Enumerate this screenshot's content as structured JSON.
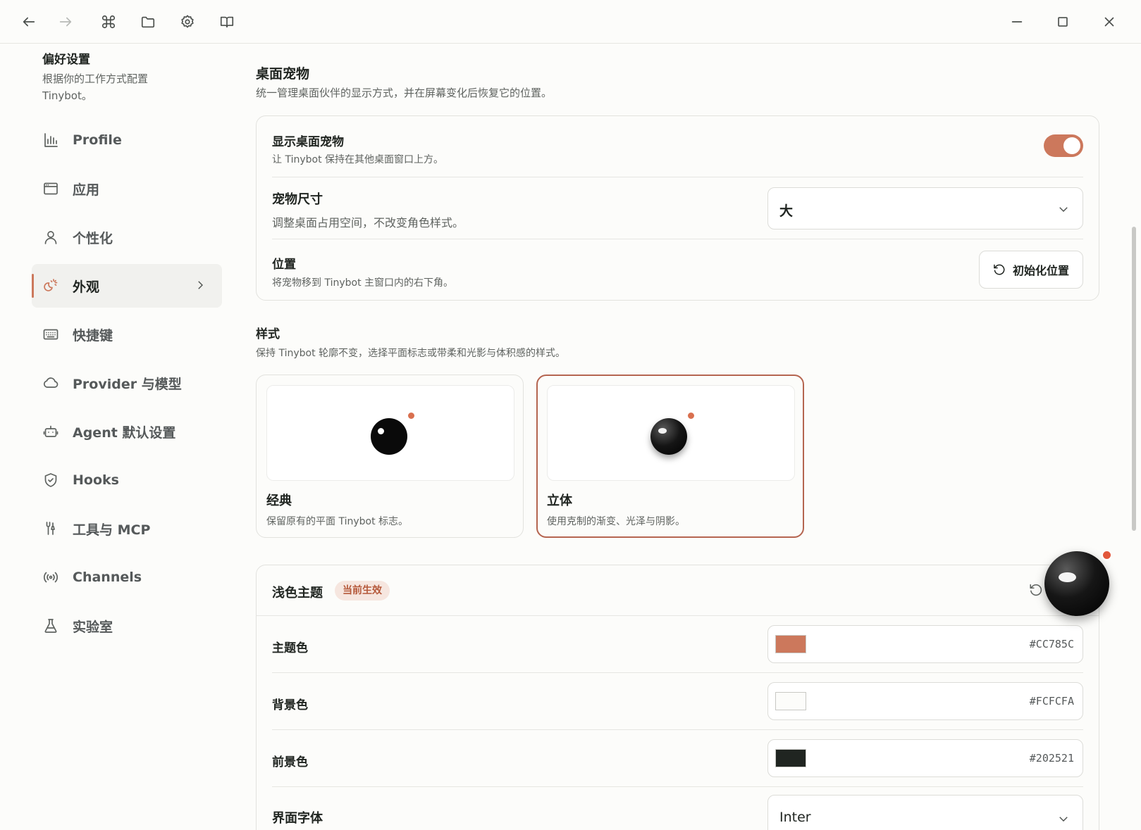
{
  "sidebar": {
    "title": "偏好设置",
    "subtitle": "根据你的工作方式配置 Tinybot。",
    "items": [
      {
        "label": "Profile"
      },
      {
        "label": "应用"
      },
      {
        "label": "个性化"
      },
      {
        "label": "外观"
      },
      {
        "label": "快捷键"
      },
      {
        "label": "Provider 与模型"
      },
      {
        "label": "Agent 默认设置"
      },
      {
        "label": "Hooks"
      },
      {
        "label": "工具与 MCP"
      },
      {
        "label": "Channels"
      },
      {
        "label": "实验室"
      }
    ],
    "active_index": 3
  },
  "pet_section": {
    "title": "桌面宠物",
    "subtitle": "统一管理桌面伙伴的显示方式，并在屏幕变化后恢复它的位置。",
    "show": {
      "title": "显示桌面宠物",
      "subtitle": "让 Tinybot 保持在其他桌面窗口上方。",
      "enabled": true
    },
    "size": {
      "title": "宠物尺寸",
      "subtitle": "调整桌面占用空间，不改变角色样式。",
      "value": "大"
    },
    "position": {
      "title": "位置",
      "subtitle": "将宠物移到 Tinybot 主窗口内的右下角。",
      "button_label": "初始化位置"
    }
  },
  "style_section": {
    "title": "样式",
    "subtitle": "保持 Tinybot 轮廓不变，选择平面标志或带柔和光影与体积感的样式。",
    "options": [
      {
        "name": "经典",
        "desc": "保留原有的平面 Tinybot 标志。",
        "selected": false
      },
      {
        "name": "立体",
        "desc": "使用克制的渐变、光泽与阴影。",
        "selected": true
      }
    ]
  },
  "theme": {
    "title": "浅色主题",
    "badge": "当前生效",
    "rows": [
      {
        "label": "主题色",
        "hex": "#CC785C"
      },
      {
        "label": "背景色",
        "hex": "#FCFCFA"
      },
      {
        "label": "前景色",
        "hex": "#202521"
      }
    ],
    "font": {
      "label": "界面字体",
      "value": "Inter"
    }
  },
  "icons": {
    "titlebar": [
      "back-icon",
      "forward-icon",
      "command-icon",
      "folder-icon",
      "settings-icon",
      "book-icon",
      "minimize-icon",
      "maximize-icon",
      "close-icon"
    ],
    "nav": [
      "bar-chart-icon",
      "window-icon",
      "user-icon",
      "appearance-icon",
      "keyboard-icon",
      "cloud-icon",
      "robot-icon",
      "shield-icon",
      "tools-icon",
      "broadcast-icon",
      "flask-icon"
    ]
  },
  "colors": {
    "accent": "#cc785c",
    "background": "#fcfcfa",
    "foreground": "#202521"
  }
}
